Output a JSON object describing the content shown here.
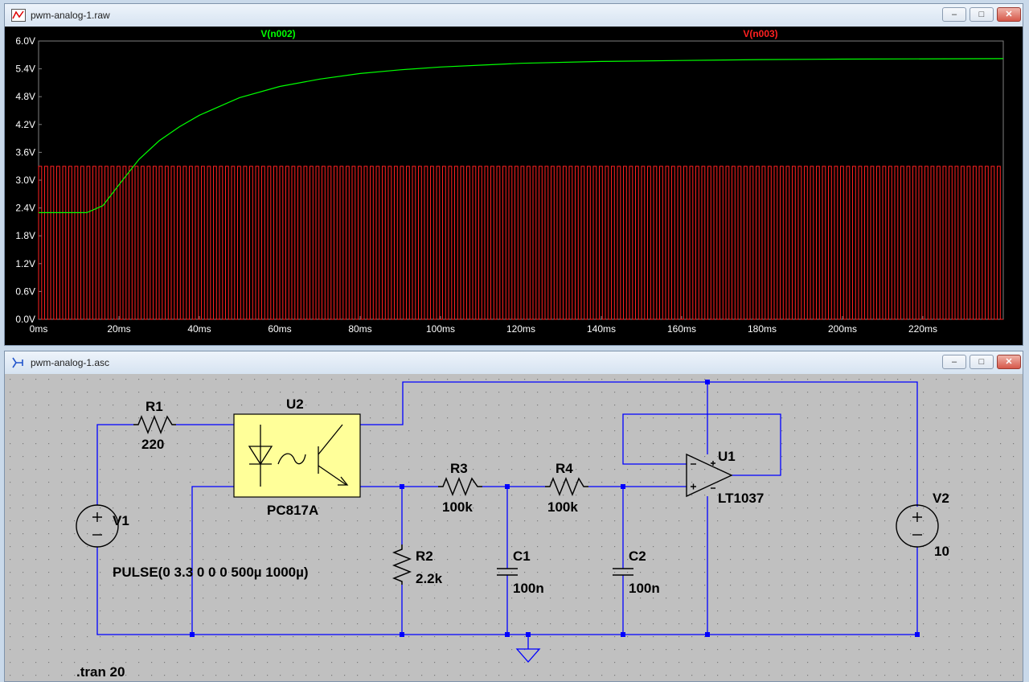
{
  "plot_window": {
    "title": "pwm-analog-1.raw",
    "icon": "waveform-icon",
    "controls": {
      "minimize": "–",
      "maximize": "□",
      "close": "✕"
    }
  },
  "schematic_window": {
    "title": "pwm-analog-1.asc",
    "icon": "schematic-icon",
    "controls": {
      "minimize": "–",
      "maximize": "□",
      "close": "✕"
    }
  },
  "chart_data": {
    "type": "line",
    "x_unit": "ms",
    "xlim": [
      0,
      240
    ],
    "ylim": [
      0,
      6.0
    ],
    "x_ticks": [
      "0ms",
      "20ms",
      "40ms",
      "60ms",
      "80ms",
      "100ms",
      "120ms",
      "140ms",
      "160ms",
      "180ms",
      "200ms",
      "220ms"
    ],
    "y_ticks": [
      "0.0V",
      "0.6V",
      "1.2V",
      "1.8V",
      "2.4V",
      "3.0V",
      "3.6V",
      "4.2V",
      "4.8V",
      "5.4V",
      "6.0V"
    ],
    "grid": false,
    "series": [
      {
        "name": "V(n002)",
        "color": "#00ff00",
        "description_points_x": [
          0,
          12,
          16,
          20,
          25,
          30,
          35,
          40,
          50,
          60,
          70,
          80,
          90,
          100,
          110,
          120,
          140,
          160,
          180,
          200,
          240
        ],
        "values": [
          2.3,
          2.3,
          2.45,
          2.9,
          3.45,
          3.85,
          4.15,
          4.4,
          4.78,
          5.02,
          5.18,
          5.3,
          5.38,
          5.44,
          5.48,
          5.52,
          5.56,
          5.58,
          5.6,
          5.61,
          5.62
        ]
      },
      {
        "name": "V(n003)",
        "color": "#ff2020",
        "kind": "pwm",
        "high": 3.3,
        "low": 0.0,
        "period_ms": 1.0
      }
    ]
  },
  "schematic": {
    "components": {
      "R1": {
        "ref": "R1",
        "value": "220"
      },
      "U2": {
        "ref": "U2",
        "value": "PC817A"
      },
      "R3": {
        "ref": "R3",
        "value": "100k"
      },
      "R4": {
        "ref": "R4",
        "value": "100k"
      },
      "U1": {
        "ref": "U1",
        "value": "LT1037"
      },
      "V1": {
        "ref": "V1",
        "value": "PULSE(0 3.3 0 0 0 500µ 1000µ)"
      },
      "R2": {
        "ref": "R2",
        "value": "2.2k"
      },
      "C1": {
        "ref": "C1",
        "value": "100n"
      },
      "C2": {
        "ref": "C2",
        "value": "100n"
      },
      "V2": {
        "ref": "V2",
        "value": "10"
      }
    },
    "directive": ".tran 20",
    "colors": {
      "wire": "#0000ff",
      "component": "#000000",
      "background": "#c0c0c0",
      "dot": "#808080"
    }
  }
}
